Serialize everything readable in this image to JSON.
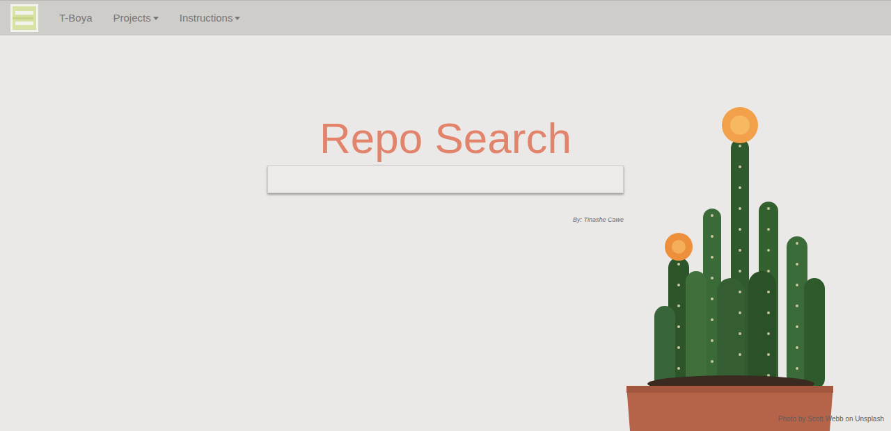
{
  "navbar": {
    "brand": "T-Boya",
    "menus": [
      {
        "label": "Projects",
        "expanded": false
      },
      {
        "label": "Instructions",
        "expanded": false
      }
    ]
  },
  "title": "Repo Search",
  "search": {
    "value": ""
  },
  "byline": "By: Tinashe Cawe",
  "photo_credit": "Photo by Scott Webb on Unsplash"
}
